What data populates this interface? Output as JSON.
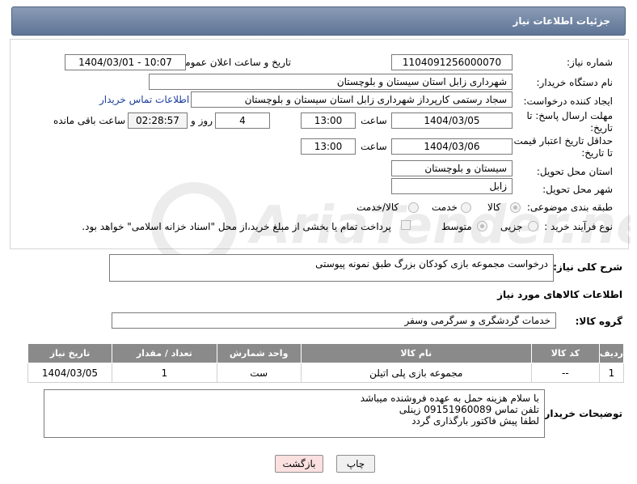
{
  "page": {
    "title": "جزئیات اطلاعات نیاز"
  },
  "fields": {
    "need_number_label": "شماره نیاز:",
    "need_number": "1104091256000070",
    "announce_label": "تاریخ و ساعت اعلان عمومی:",
    "announce_value": "1404/03/01 - 10:07",
    "buyer_org_label": "نام دستگاه خریدار:",
    "buyer_org": "شهرداری زابل استان سیستان و بلوچستان",
    "creator_label": "ایجاد کننده درخواست:",
    "creator": "سجاد رستمی کارپرداز شهرداری زابل استان سیستان و بلوچستان",
    "contact_link": "اطلاعات تماس خریدار",
    "deadline_label_1": "مهلت ارسال پاسخ: تا",
    "deadline_label_2": "تاریخ:",
    "deadline_date": "1404/03/05",
    "time_label": "ساعت",
    "deadline_time": "13:00",
    "days_value": "4",
    "days_label": "روز و",
    "remaining_time": "02:28:57",
    "remaining_label": "ساعت باقی مانده",
    "validity_label_1": "حداقل تاریخ اعتبار قیمت:",
    "validity_label_2": "تا تاریخ:",
    "validity_date": "1404/03/06",
    "validity_time": "13:00",
    "province_label": "استان محل تحویل:",
    "province": "سیستان و بلوچستان",
    "city_label": "شهر محل تحویل:",
    "city": "زابل",
    "category_label": "طبقه بندی موضوعی:",
    "category_options": [
      "کالا",
      "خدمت",
      "کالا/خدمت"
    ],
    "process_label": "نوع فرآیند خرید :",
    "process_options": [
      "جزیی",
      "متوسط"
    ],
    "payment_note": "پرداخت تمام یا بخشی از مبلغ خرید،از محل \"اسناد خزانه اسلامی\" خواهد بود."
  },
  "description": {
    "label": "شرح کلی نیاز:",
    "value": "درخواست مجموعه بازی کودکان بزرگ طبق نمونه پیوستی"
  },
  "goods": {
    "section_title": "اطلاعات کالاهای مورد نیاز",
    "group_label": "گروه کالا:",
    "group_value": "خدمات گردشگری و سرگرمی وسفر",
    "columns": [
      "ردیف",
      "کد کالا",
      "نام کالا",
      "واحد شمارش",
      "تعداد / مقدار",
      "تاریخ نیاز"
    ],
    "rows": [
      [
        "1",
        "--",
        "مجموعه بازی پلی اتیلن",
        "ست",
        "1",
        "1404/03/05"
      ]
    ]
  },
  "buyer_notes": {
    "label": "توضیحات خریدار:",
    "lines": [
      "با سلام هزینه حمل به عهده فروشنده میباشد",
      "تلفن تماس 09151960089 زینلی",
      "لطفا پیش فاکتور بارگذاری گردد"
    ]
  },
  "buttons": {
    "print": "چاپ",
    "back": "بازگشت"
  },
  "watermark": "AriaTender.net"
}
